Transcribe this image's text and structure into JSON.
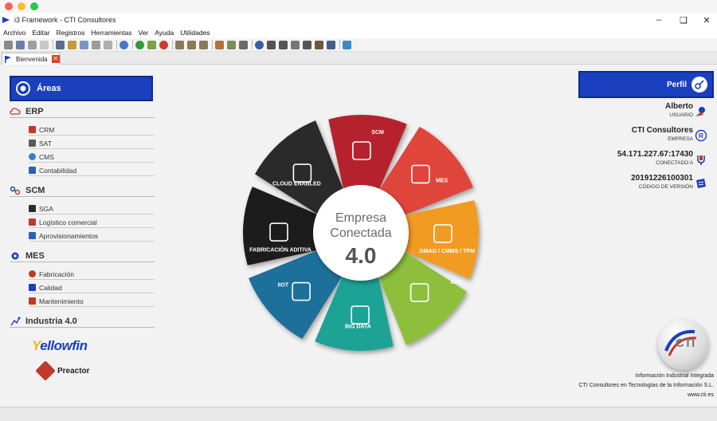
{
  "window": {
    "title": "i3 Framework - CTI Consultores",
    "controls": [
      "–",
      "❏",
      "✕"
    ]
  },
  "menu": [
    "Archivo",
    "Editar",
    "Registros",
    "Herramientas",
    "Ver",
    "Ayuda",
    "Utilidades"
  ],
  "tab": {
    "label": "Bienvenida",
    "close": "✕"
  },
  "sidebar": {
    "header": "Áreas",
    "sections": [
      {
        "title": "ERP",
        "icon": "erp-cloud-icon",
        "items": [
          "CRM",
          "SAT",
          "CMS",
          "Contabilidad"
        ]
      },
      {
        "title": "SCM",
        "icon": "scm-link-icon",
        "items": [
          "SGA",
          "Logístico comercial",
          "Aprovisionamientos"
        ]
      },
      {
        "title": "MES",
        "icon": "mes-gears-icon",
        "items": [
          "Fabricación",
          "Calidad",
          "Mantenimiento"
        ]
      },
      {
        "title": "Industria 4.0",
        "icon": "industria-icon",
        "items": []
      }
    ],
    "brands": {
      "yellowfin_a": "Y",
      "yellowfin_b": "ellowfin",
      "preactor": "Preactor"
    }
  },
  "wheel": {
    "center_line1": "Empresa",
    "center_line2": "Conectada",
    "center_line3": "4.0",
    "segments": [
      {
        "label": "SCM",
        "color": "#b5232e"
      },
      {
        "label": "MES",
        "color": "#e0453a"
      },
      {
        "label": "GMAO / CMMS / TPM",
        "color": "#f29b20"
      },
      {
        "label": "APS",
        "color": "#8dbf3e"
      },
      {
        "label": "BIG DATA",
        "color": "#1aa395"
      },
      {
        "label": "IIOT",
        "color": "#1b6f9a"
      },
      {
        "label": "FABRICACIÓN ADITIVA",
        "color": "#1c1c1c"
      },
      {
        "label": "CLOUD ENABLED",
        "color": "#2b2b2b"
      }
    ]
  },
  "profile": {
    "button": "Perfil",
    "user_value": "Alberto",
    "user_label": "USUARIO",
    "company_value": "CTI Consultores",
    "company_label": "EMPRESA",
    "connection_value": "54.171.227.67:17430",
    "connection_label": "CONECTADO A",
    "version_value": "20191226100301",
    "version_label": "CÓDIGO DE VERSIÓN"
  },
  "footer": {
    "logo_text": "CTI",
    "line1": "Información Industrial Integrada",
    "line2": "CTI Consultores en Tecnologías de la Información S.L.",
    "line3": "www.cti.es"
  },
  "colors": {
    "accent_blue": "#1a3fbf",
    "close_red": "#d9432a"
  }
}
